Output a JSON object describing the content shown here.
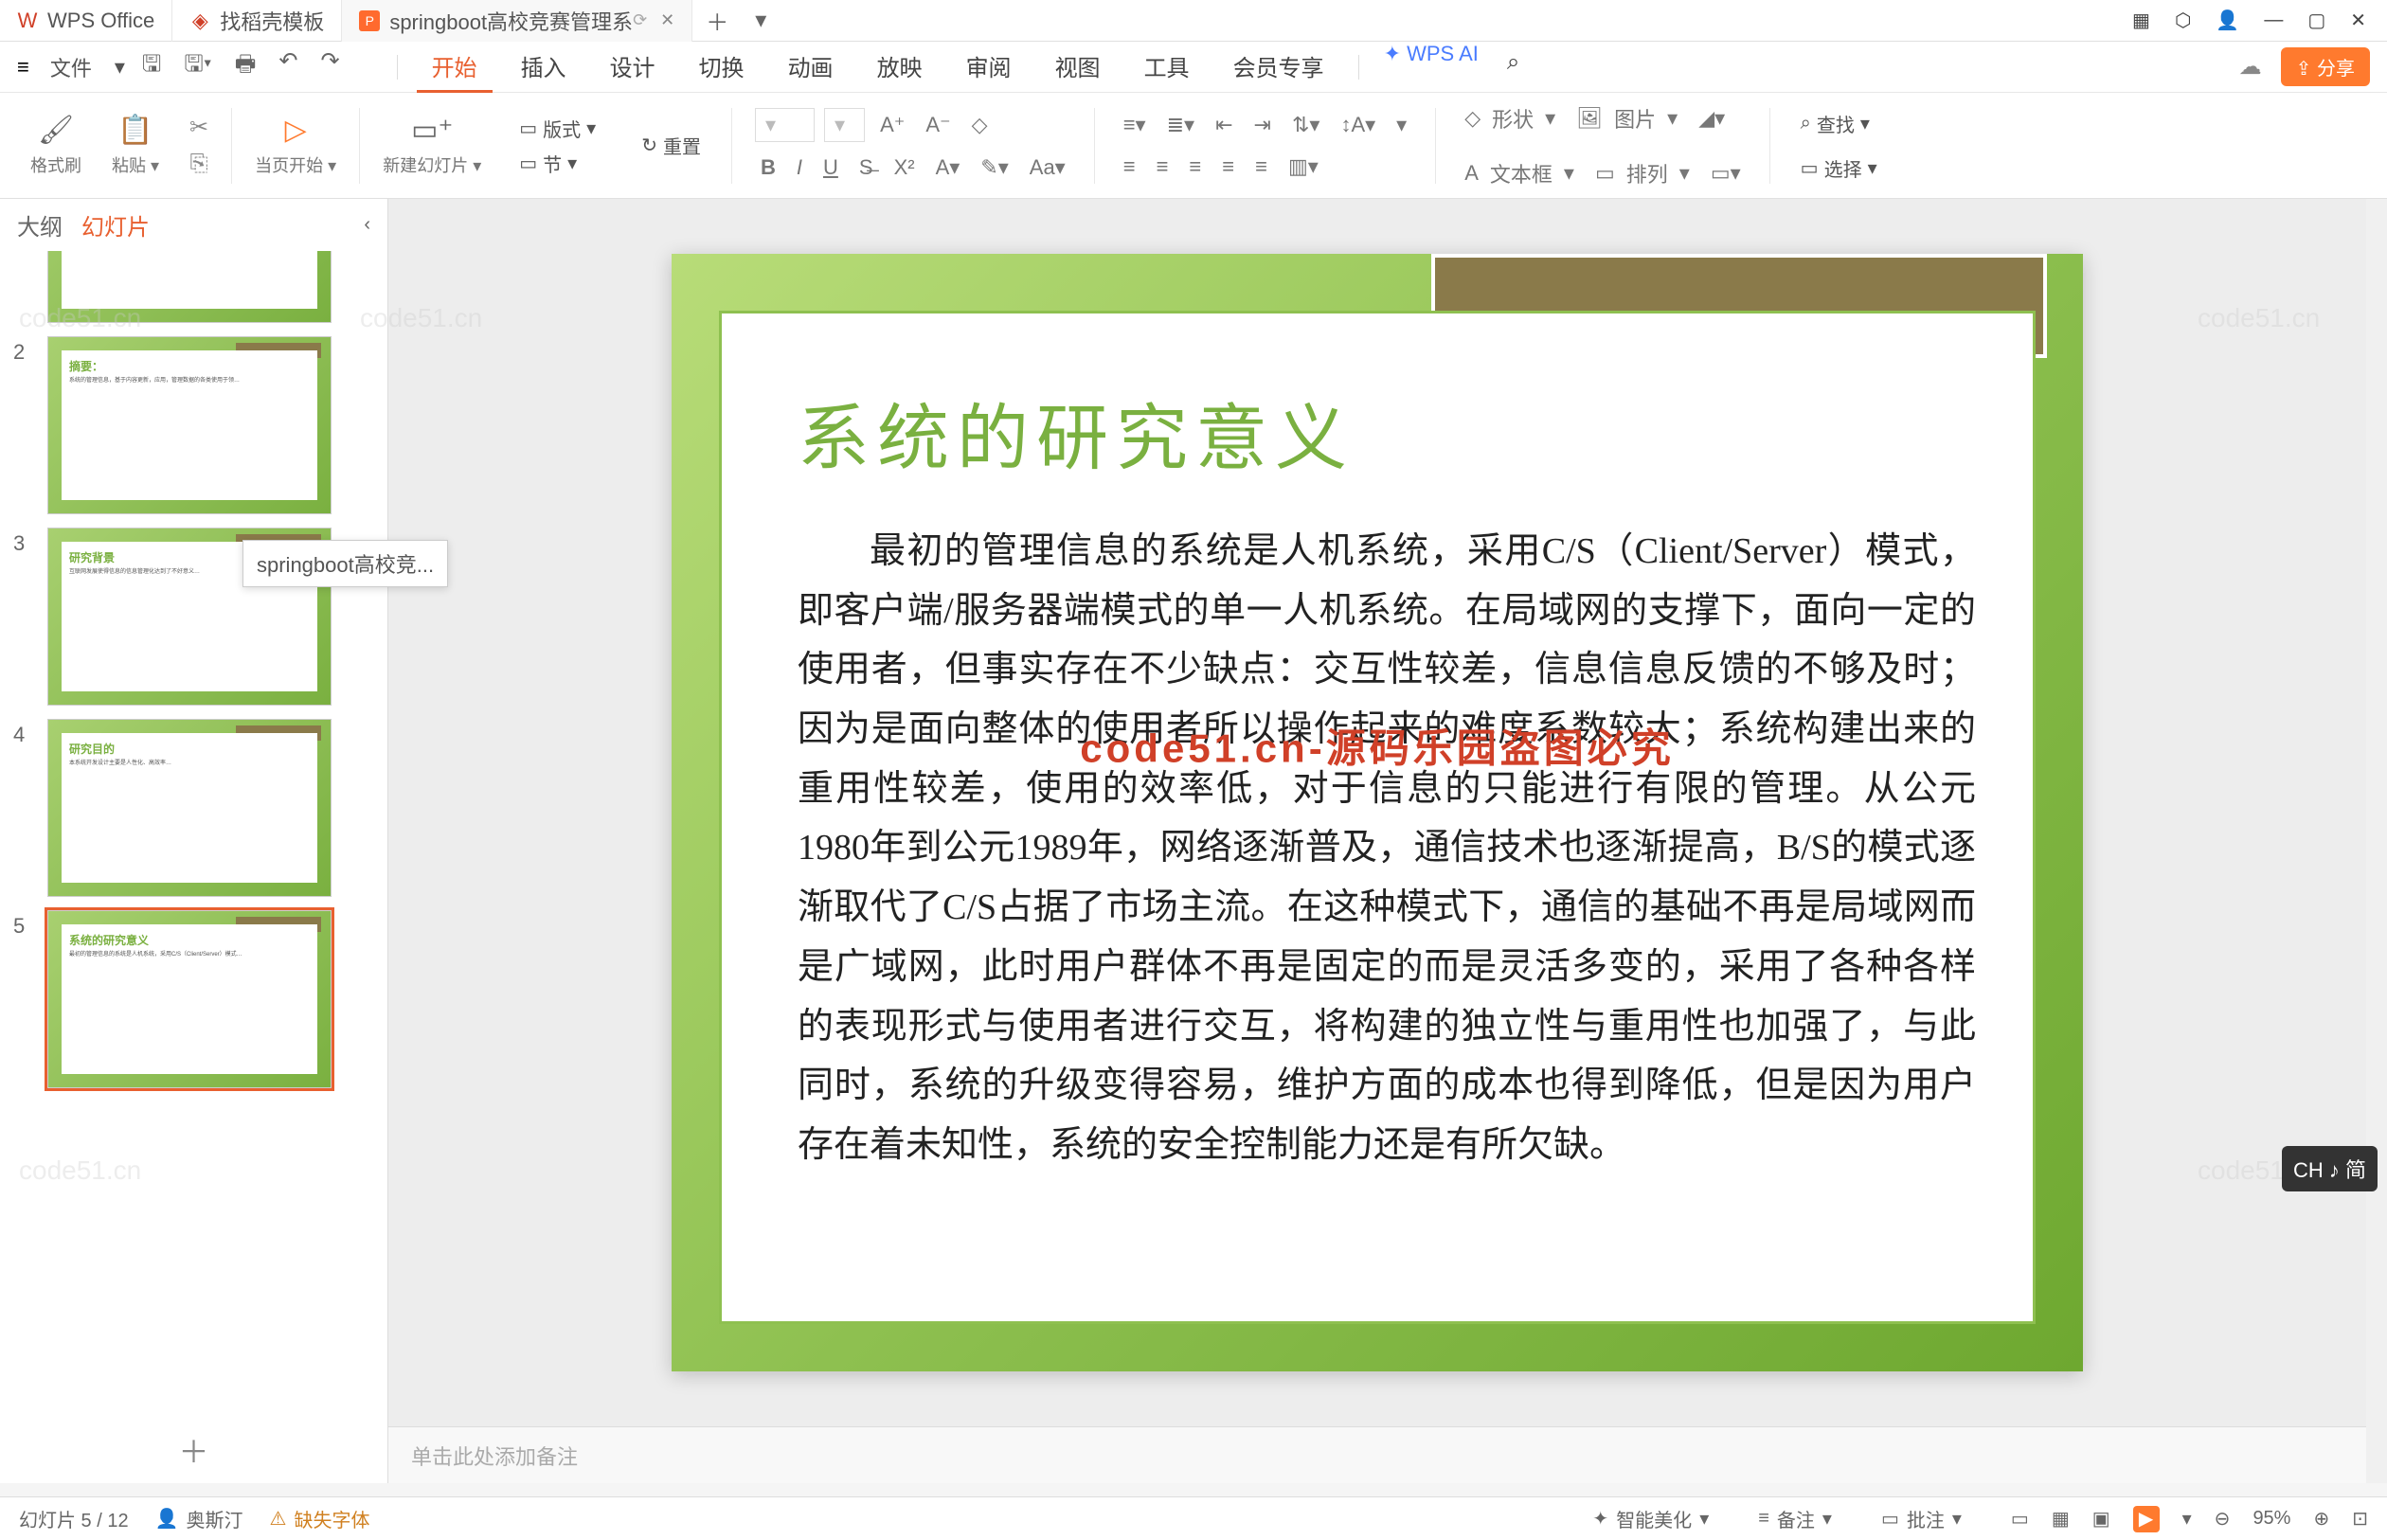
{
  "titlebar": {
    "tab1": "WPS Office",
    "tab2": "找稻壳模板",
    "tab3": "springboot高校竞赛管理系",
    "tab3_suffix": "…"
  },
  "menubar": {
    "file": "文件",
    "tabs": [
      "开始",
      "插入",
      "设计",
      "切换",
      "动画",
      "放映",
      "审阅",
      "视图",
      "工具",
      "会员专享"
    ],
    "ai": "WPS AI"
  },
  "ribbon": {
    "format_brush": "格式刷",
    "paste": "粘贴",
    "from_current": "当页开始",
    "new_slide": "新建幻灯片",
    "layout": "版式",
    "section": "节",
    "reset": "重置",
    "shape": "形状",
    "picture": "图片",
    "textbox": "文本框",
    "arrange": "排列",
    "find": "查找",
    "select": "选择"
  },
  "sidepanel": {
    "outline": "大纲",
    "slides": "幻灯片",
    "tooltip": "springboot高校竞...",
    "thumbs": {
      "t2_title": "摘要：",
      "t3_title": "研究背景",
      "t4_title": "研究目的",
      "t5_title": "系统的研究意义"
    }
  },
  "slide": {
    "title": "系统的研究意义",
    "content": "最初的管理信息的系统是人机系统，采用C/S（Client/Server）模式，即客户端/服务器端模式的单一人机系统。在局域网的支撑下，面向一定的使用者，但事实存在不少缺点：交互性较差，信息信息反馈的不够及时；因为是面向整体的使用者所以操作起来的难度系数较大；系统构建出来的重用性较差，使用的效率低，对于信息的只能进行有限的管理。从公元1980年到公元1989年，网络逐渐普及，通信技术也逐渐提高，B/S的模式逐渐取代了C/S占据了市场主流。在这种模式下，通信的基础不再是局域网而是广域网，此时用户群体不再是固定的而是灵活多变的，采用了各种各样的表现形式与使用者进行交互，将构建的独立性与重用性也加强了，与此同时，系统的升级变得容易，维护方面的成本也得到降低，但是因为用户存在着未知性，系统的安全控制能力还是有所欠缺。",
    "overlay": "code51.cn-源码乐园盗图必究"
  },
  "notes": {
    "placeholder": "单击此处添加备注"
  },
  "status": {
    "slide_count": "幻灯片 5 / 12",
    "author": "奥斯汀",
    "missing_font": "缺失字体",
    "beautify": "智能美化",
    "remark": "备注",
    "review": "批注",
    "zoom": "95%"
  },
  "ime": "CH ♪ 简",
  "watermark": "code51.cn"
}
